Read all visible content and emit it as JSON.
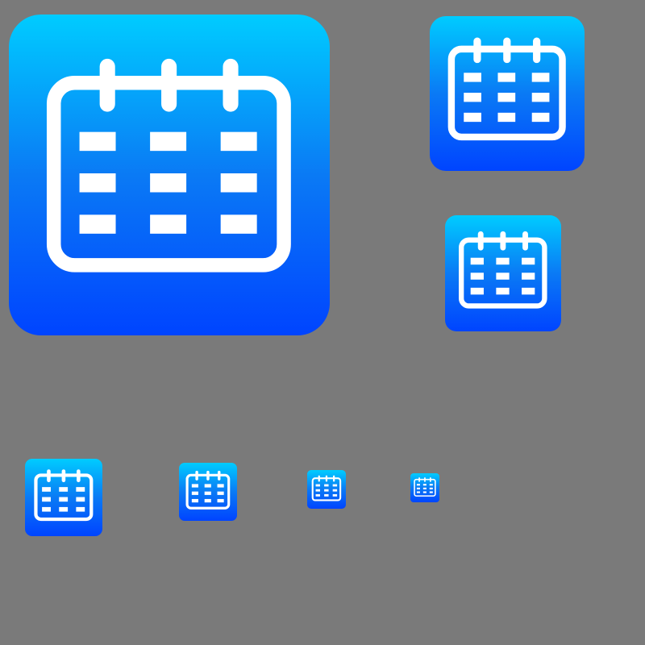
{
  "canvas": {
    "background_color": "#7a7a7a"
  },
  "icon": {
    "name": "calendar-icon",
    "glyph_color": "#ffffff",
    "gradient_top": "#00ccff",
    "gradient_bottom": "#0044ff",
    "grid_rows": 3,
    "grid_columns": 3,
    "ring_count": 3
  },
  "icon_sizes": [
    "xl",
    "l",
    "m",
    "s1",
    "s2",
    "s3",
    "s4"
  ]
}
